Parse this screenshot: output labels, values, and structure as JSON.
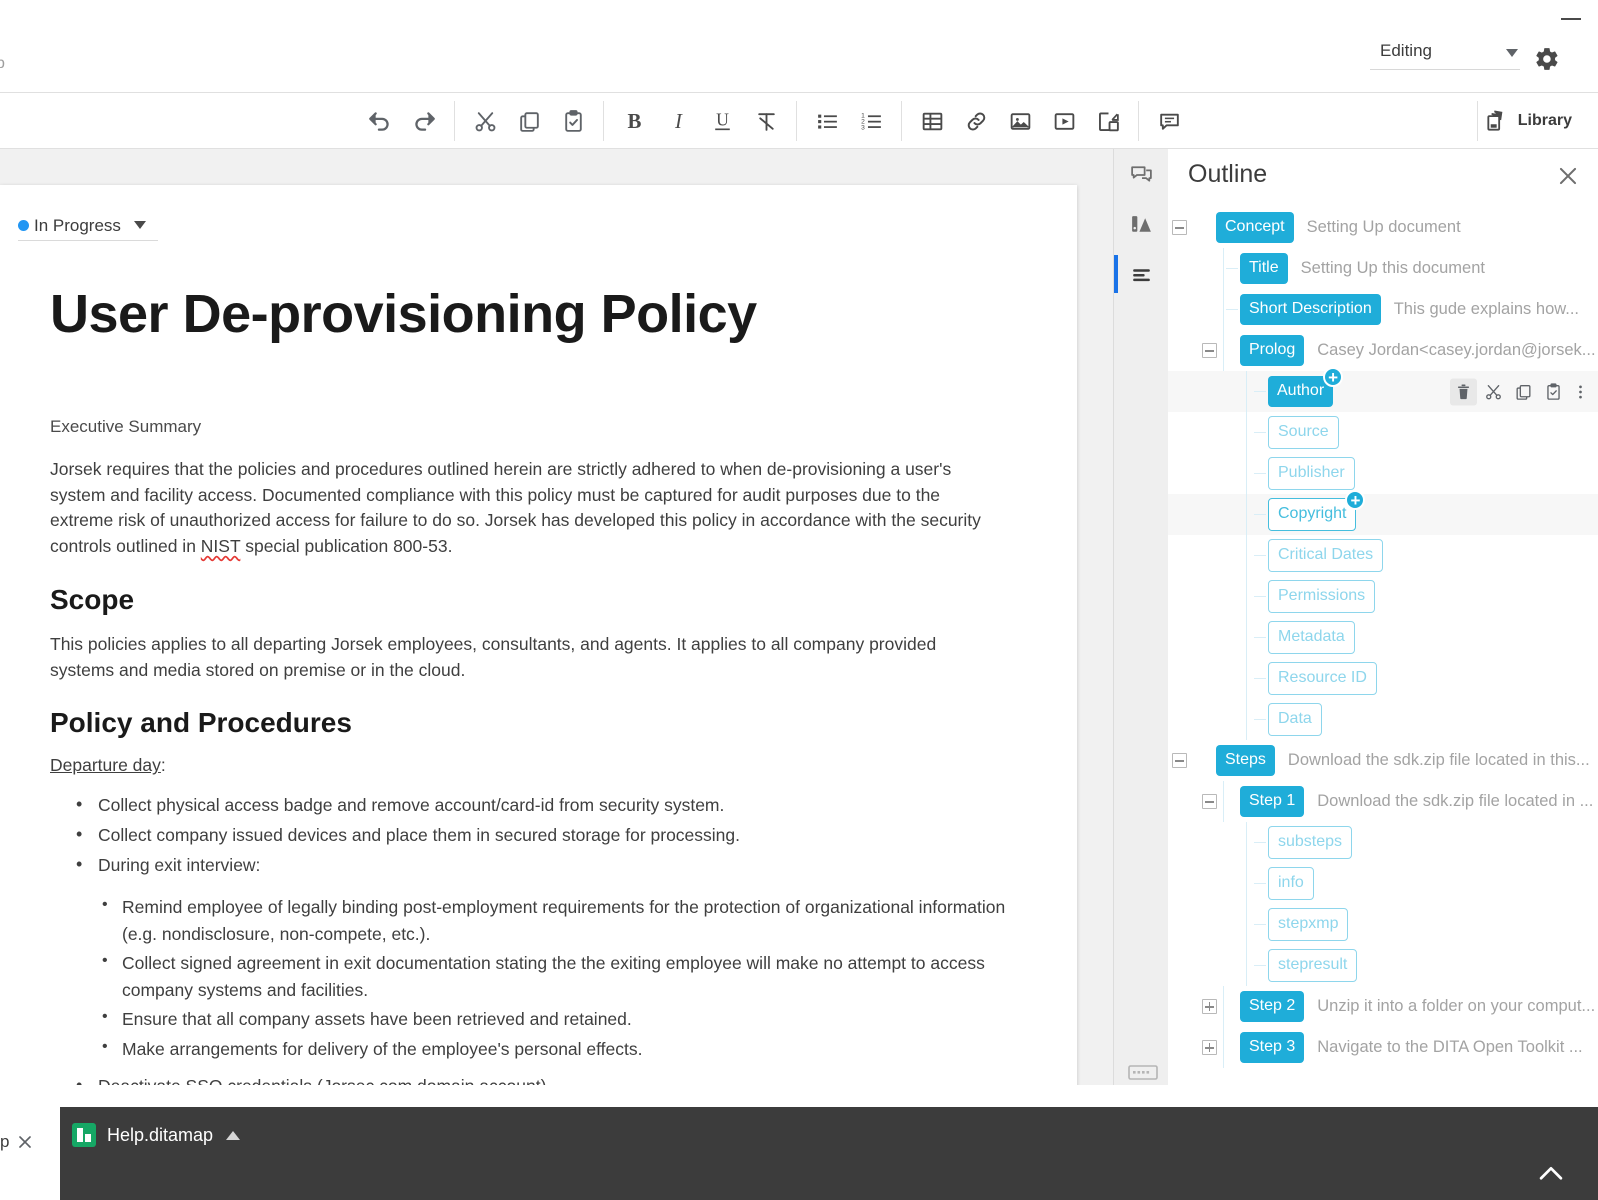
{
  "window": {
    "left_tab_fragment": "p",
    "minimize_icon": "minimize-icon"
  },
  "header": {
    "mode_label": "Editing",
    "settings_icon": "gear-icon",
    "dropdown_icon": "chevron-down-icon"
  },
  "toolbar": {
    "groups": [
      {
        "name": "history",
        "buttons": [
          {
            "name": "undo-button",
            "icon": "undo-icon",
            "tooltip": "Undo"
          },
          {
            "name": "redo-button",
            "icon": "redo-icon",
            "tooltip": "Redo"
          }
        ]
      },
      {
        "name": "clipboard",
        "buttons": [
          {
            "name": "cut-button",
            "icon": "scissors-icon",
            "tooltip": "Cut"
          },
          {
            "name": "copy-button",
            "icon": "copy-icon",
            "tooltip": "Copy"
          },
          {
            "name": "paste-button",
            "icon": "clipboard-check-icon",
            "tooltip": "Paste"
          }
        ]
      },
      {
        "name": "text-format",
        "buttons": [
          {
            "name": "bold-button",
            "icon": "bold-icon",
            "tooltip": "Bold",
            "glyph": "B"
          },
          {
            "name": "italic-button",
            "icon": "italic-icon",
            "tooltip": "Italic",
            "glyph": "I"
          },
          {
            "name": "underline-button",
            "icon": "underline-icon",
            "tooltip": "Underline",
            "glyph": "U"
          },
          {
            "name": "clear-format-button",
            "icon": "clear-formatting-icon",
            "tooltip": "Clear formatting"
          }
        ]
      },
      {
        "name": "lists",
        "buttons": [
          {
            "name": "bulleted-list-button",
            "icon": "bulleted-list-icon",
            "tooltip": "Bulleted list"
          },
          {
            "name": "numbered-list-button",
            "icon": "numbered-list-icon",
            "tooltip": "Numbered list"
          }
        ]
      },
      {
        "name": "insert",
        "buttons": [
          {
            "name": "insert-table-button",
            "icon": "table-icon",
            "tooltip": "Insert table"
          },
          {
            "name": "insert-link-button",
            "icon": "link-icon",
            "tooltip": "Insert link"
          },
          {
            "name": "insert-image-button",
            "icon": "image-icon",
            "tooltip": "Insert image"
          },
          {
            "name": "insert-video-button",
            "icon": "video-icon",
            "tooltip": "Insert video"
          },
          {
            "name": "insert-reuse-button",
            "icon": "insert-content-reference-icon",
            "tooltip": "Insert content reference"
          }
        ]
      },
      {
        "name": "comment",
        "buttons": [
          {
            "name": "add-comment-button",
            "icon": "comment-icon",
            "tooltip": "Add comment"
          }
        ]
      }
    ],
    "library_label": "Library",
    "library_icon": "library-icon"
  },
  "document": {
    "status": {
      "label": "In Progress",
      "dot_color": "#2196f3",
      "caret_icon": "chevron-down-icon"
    },
    "title": "User De-provisioning Policy",
    "exec_label": "Executive Summary",
    "summary_paragraph": "Jorsek requires that the policies and procedures outlined herein are strictly adhered to when de-provisioning a user's system and facility access. Documented compliance with this policy must be captured for audit purposes due to the extreme risk of unauthorized access for failure to do so. Jorsek has developed this policy in accordance with the security controls outlined in NIST special publication 800-53.",
    "summary_part_1": "Jorsek requires that the policies and procedures outlined herein are strictly adhered to when de-provisioning a user's system and facility access. Documented compliance with this policy must be captured for audit purposes due to the extreme risk of unauthorized access for failure to do so. Jorsek has developed this policy in accordance with the security controls outlined in ",
    "summary_misspelled": "NIST",
    "summary_part_2": " special publication 800-53.",
    "scope_heading": "Scope",
    "scope_paragraph": "This policies applies to all departing Jorsek employees, consultants, and agents. It applies to all company provided systems and media stored on premise or in the cloud.",
    "policy_heading": "Policy and Procedures",
    "departure_label": "Departure day",
    "departure_colon": ":",
    "bullets_level1": [
      "Collect physical access badge and remove account/card-id from security system.",
      "Collect company issued devices and place them in secured storage for processing.",
      "During exit interview:"
    ],
    "bullets_level2": [
      "Remind employee of legally binding post-employment requirements for the protection of organizational information (e.g. nondisclosure, non-compete, etc.).",
      "Collect signed agreement in exit documentation stating the the exiting employee will make no attempt to access company systems and facilities.",
      "Ensure that all company assets have been retrieved and retained.",
      "Make arrangements for delivery of the employee's personal effects."
    ],
    "last_bullet_prefix": "Deactivate SSO credentials (",
    "last_bullet_misspelled": "Jorsec",
    "last_bullet_suffix": ".com domain account)"
  },
  "rail": {
    "items": [
      {
        "name": "comments-panel-button",
        "icon": "comments-icon",
        "active": false
      },
      {
        "name": "review-panel-button",
        "icon": "track-changes-icon",
        "active": false
      },
      {
        "name": "outline-panel-button",
        "icon": "outline-icon",
        "active": true
      }
    ],
    "keyboard_icon": "keyboard-icon"
  },
  "outline": {
    "title": "Outline",
    "close_icon": "close-icon",
    "row_actions": [
      {
        "name": "delete-element-button",
        "icon": "trash-icon",
        "selected": true
      },
      {
        "name": "cut-element-button",
        "icon": "scissors-icon",
        "selected": false
      },
      {
        "name": "copy-element-button",
        "icon": "copy-icon",
        "selected": false
      },
      {
        "name": "paste-element-button",
        "icon": "clipboard-check-icon",
        "selected": false
      },
      {
        "name": "more-options-button",
        "icon": "more-vertical-icon",
        "selected": false
      }
    ],
    "nodes": [
      {
        "chip": "Concept",
        "text": "Setting Up document",
        "style": "filled",
        "indent": 0,
        "toggle": "minus",
        "plus": false,
        "highlight": false
      },
      {
        "chip": "Title",
        "text": "Setting Up  this document",
        "style": "filled",
        "indent": 1,
        "toggle": "none",
        "plus": false,
        "highlight": false
      },
      {
        "chip": "Short Description",
        "text": "This gude explains how...",
        "style": "filled",
        "indent": 1,
        "toggle": "none",
        "plus": false,
        "highlight": false
      },
      {
        "chip": "Prolog",
        "text": "Casey Jordan<casey.jordan@jorsek...",
        "style": "filled",
        "indent": 1,
        "toggle": "minus",
        "plus": false,
        "highlight": false
      },
      {
        "chip": "Author",
        "text": "",
        "style": "filled",
        "indent": 2,
        "toggle": "none",
        "plus": true,
        "highlight": true,
        "actions": true
      },
      {
        "chip": "Source",
        "text": "",
        "style": "outline",
        "indent": 2,
        "toggle": "none",
        "plus": false,
        "highlight": false
      },
      {
        "chip": "Publisher",
        "text": "",
        "style": "outline",
        "indent": 2,
        "toggle": "none",
        "plus": false,
        "highlight": false
      },
      {
        "chip": "Copyright",
        "text": "",
        "style": "outline-strong",
        "indent": 2,
        "toggle": "none",
        "plus": true,
        "highlight": true
      },
      {
        "chip": "Critical Dates",
        "text": "",
        "style": "outline",
        "indent": 2,
        "toggle": "none",
        "plus": false,
        "highlight": false
      },
      {
        "chip": "Permissions",
        "text": "",
        "style": "outline",
        "indent": 2,
        "toggle": "none",
        "plus": false,
        "highlight": false
      },
      {
        "chip": "Metadata",
        "text": "",
        "style": "outline",
        "indent": 2,
        "toggle": "none",
        "plus": false,
        "highlight": false
      },
      {
        "chip": "Resource ID",
        "text": "",
        "style": "outline",
        "indent": 2,
        "toggle": "none",
        "plus": false,
        "highlight": false
      },
      {
        "chip": "Data",
        "text": "",
        "style": "outline",
        "indent": 2,
        "toggle": "none",
        "plus": false,
        "highlight": false
      },
      {
        "chip": "Steps",
        "text": "Download the sdk.zip file located in this...",
        "style": "filled",
        "indent": 0,
        "toggle": "minus",
        "plus": false,
        "highlight": false
      },
      {
        "chip": "Step 1",
        "text": "Download the sdk.zip file located in ...",
        "style": "filled",
        "indent": 1,
        "toggle": "minus",
        "plus": false,
        "highlight": false
      },
      {
        "chip": "substeps",
        "text": "",
        "style": "outline",
        "indent": 2,
        "toggle": "none",
        "plus": false,
        "highlight": false
      },
      {
        "chip": "info",
        "text": "",
        "style": "outline",
        "indent": 2,
        "toggle": "none",
        "plus": false,
        "highlight": false
      },
      {
        "chip": "stepxmp",
        "text": "",
        "style": "outline",
        "indent": 2,
        "toggle": "none",
        "plus": false,
        "highlight": false
      },
      {
        "chip": "stepresult",
        "text": "",
        "style": "outline",
        "indent": 2,
        "toggle": "none",
        "plus": false,
        "highlight": false
      },
      {
        "chip": "Step 2",
        "text": "Unzip it into a folder on your comput...",
        "style": "filled",
        "indent": 1,
        "toggle": "plus",
        "plus": false,
        "highlight": false
      },
      {
        "chip": "Step 3",
        "text": "Navigate to the DITA Open Toolkit ...",
        "style": "filled",
        "indent": 1,
        "toggle": "plus",
        "plus": false,
        "highlight": false
      }
    ]
  },
  "bottom": {
    "prev_tab_fragment": "p",
    "prev_tab_close_icon": "close-icon",
    "ditamap_name": "Help.ditamap",
    "ditamap_icon": "ditamap-icon",
    "ditamap_caret_icon": "chevron-up-icon",
    "expand_icon": "chevron-up-icon"
  },
  "colors": {
    "accent_blue": "#1fadd9",
    "chip_outline": "#8ed6ec",
    "status_blue": "#2196f3",
    "active_rail": "#1a73e8",
    "dark_bar": "#3c3c3c",
    "ditamap_green": "#16a765"
  }
}
